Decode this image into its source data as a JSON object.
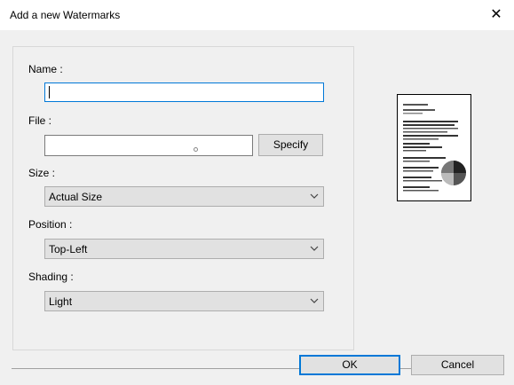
{
  "window": {
    "title": "Add a new Watermarks",
    "close_icon": "close-icon"
  },
  "form": {
    "name_label": "Name :",
    "name_value": "",
    "file_label": "File :",
    "file_value": "",
    "specify_label": "Specify",
    "size_label": "Size :",
    "size_value": "Actual Size",
    "position_label": "Position :",
    "position_value": "Top-Left",
    "shading_label": "Shading :",
    "shading_value": "Light"
  },
  "buttons": {
    "ok_label": "OK",
    "cancel_label": "Cancel"
  },
  "colors": {
    "focus_border": "#0078d7",
    "dialog_bg": "#f0f0f0"
  }
}
